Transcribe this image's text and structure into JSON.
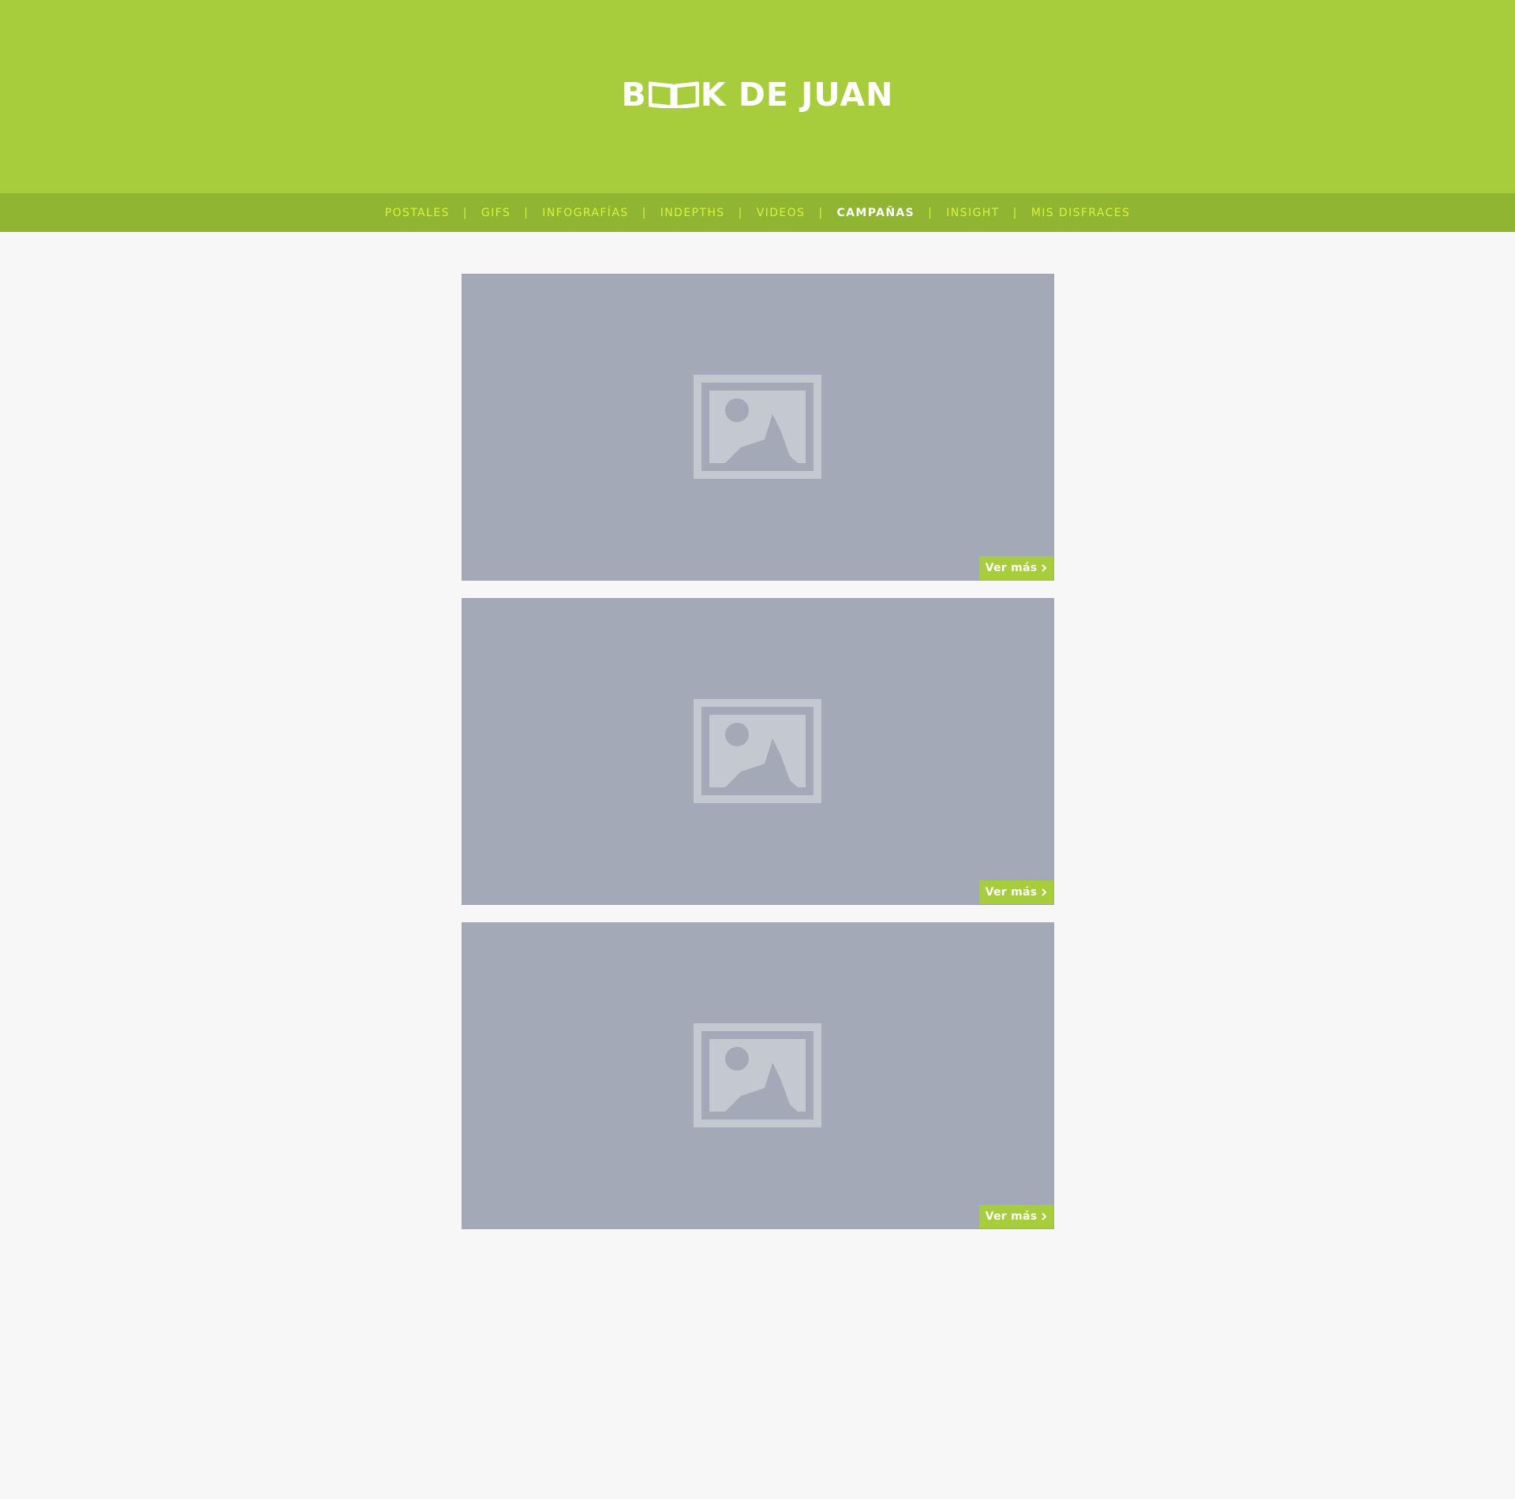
{
  "colors": {
    "header_bg": "#a8cd3c",
    "nav_bg": "#8fb532",
    "nav_text": "#d8f33f",
    "nav_active": "#ffffff",
    "page_bg": "#f7f7f7",
    "placeholder_bg": "#a3a9b6",
    "button_bg": "#a8cd3c"
  },
  "header": {
    "logo_left": "B",
    "logo_right": "K DE JUAN",
    "logo_icon": "open-book-icon"
  },
  "nav": {
    "items": [
      {
        "label": "POSTALES",
        "active": false
      },
      {
        "label": "GIFS",
        "active": false
      },
      {
        "label": "INFOGRAFÍAS",
        "active": false
      },
      {
        "label": "INDEPTHS",
        "active": false
      },
      {
        "label": "VIDEOS",
        "active": false
      },
      {
        "label": "CAMPAÑAS",
        "active": true
      },
      {
        "label": "INSIGHT",
        "active": false
      },
      {
        "label": "MIS DISFRACES",
        "active": false
      }
    ],
    "separator": "|"
  },
  "cards": [
    {
      "image_icon": "image-placeholder-icon",
      "button_label": "Ver más",
      "button_icon": "chevron-right-icon"
    },
    {
      "image_icon": "image-placeholder-icon",
      "button_label": "Ver más",
      "button_icon": "chevron-right-icon"
    },
    {
      "image_icon": "image-placeholder-icon",
      "button_label": "Ver más",
      "button_icon": "chevron-right-icon"
    }
  ]
}
